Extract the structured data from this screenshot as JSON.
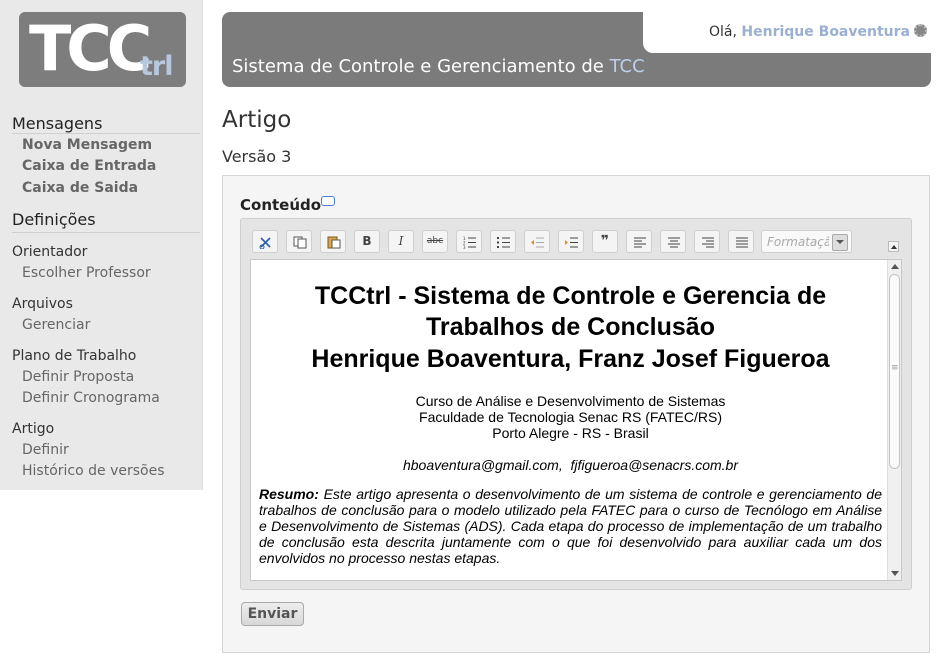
{
  "logo": {
    "main": "TCC",
    "suffix": "trl"
  },
  "sidebar": {
    "sections": [
      {
        "title": "Mensagens",
        "links": [
          "Nova Mensagem",
          "Caixa de Entrada",
          "Caixa de Saida"
        ]
      },
      {
        "title": "Definições"
      }
    ],
    "groups": [
      {
        "title": "Orientador",
        "links": [
          "Escolher Professor"
        ]
      },
      {
        "title": "Arquivos",
        "links": [
          "Gerenciar"
        ]
      },
      {
        "title": "Plano de Trabalho",
        "links": [
          "Definir Proposta",
          "Definir Cronograma"
        ]
      },
      {
        "title": "Artigo",
        "links": [
          "Definir",
          "Histórico de versões"
        ]
      }
    ]
  },
  "header": {
    "greeting": "Olá,",
    "user_name": "Henrique Boaventura",
    "system_title_prefix": "Sistema de Controle e Gerenciamento de ",
    "system_title_tcc": "TCC"
  },
  "main": {
    "page_title": "Artigo",
    "version": "Versão 3",
    "content_label": "Conteúdo",
    "send_label": "Enviar"
  },
  "editor": {
    "format_placeholder": "Formatação",
    "toolbar": [
      {
        "name": "cut-button",
        "icon": "scissors-icon"
      },
      {
        "name": "copy-button",
        "icon": "copy-icon"
      },
      {
        "name": "paste-button",
        "icon": "paste-icon"
      },
      {
        "name": "bold-button",
        "icon": "bold-icon"
      },
      {
        "name": "italic-button",
        "icon": "italic-icon"
      },
      {
        "name": "strikethrough-button",
        "icon": "strikethrough-icon"
      },
      {
        "name": "ordered-list-button",
        "icon": "ordered-list-icon"
      },
      {
        "name": "unordered-list-button",
        "icon": "unordered-list-icon"
      },
      {
        "name": "outdent-button",
        "icon": "outdent-icon"
      },
      {
        "name": "indent-button",
        "icon": "indent-icon"
      },
      {
        "name": "blockquote-button",
        "icon": "quote-icon"
      },
      {
        "name": "align-left-button",
        "icon": "align-left-icon"
      },
      {
        "name": "align-center-button",
        "icon": "align-center-icon"
      },
      {
        "name": "align-right-button",
        "icon": "align-right-icon"
      },
      {
        "name": "justify-button",
        "icon": "justify-icon"
      }
    ],
    "document": {
      "title_lines": [
        "TCCtrl - Sistema de Controle e Gerencia de",
        "Trabalhos de Conclusão",
        "Henrique Boaventura, Franz Josef Figueroa"
      ],
      "affiliation_lines": [
        "Curso de Análise e Desenvolvimento de Sistemas",
        "Faculdade de Tecnologia Senac RS (FATEC/RS)",
        "Porto Alegre - RS - Brasil"
      ],
      "emails": "hboaventura@gmail.com,  fjfigueroa@senacrs.com.br",
      "abstract_label": "Resumo:",
      "abstract_text": "Este artigo apresenta  o desenvolvimento de um sistema de controle e gerenciamento de trabalhos de conclusão para o modelo utilizado pela FATEC para o curso de Tecnólogo em Análise e Desenvolvimento de Sistemas (ADS). Cada etapa do processo de implementação de um trabalho de conclusão esta descrita juntamente com o que foi desenvolvido para auxiliar cada um dos envolvidos no processo nestas etapas."
    }
  },
  "colors": {
    "accent": "#9bb0d0",
    "header_bg": "#7b7b7b",
    "sidebar_bg": "#e9e9e9"
  }
}
